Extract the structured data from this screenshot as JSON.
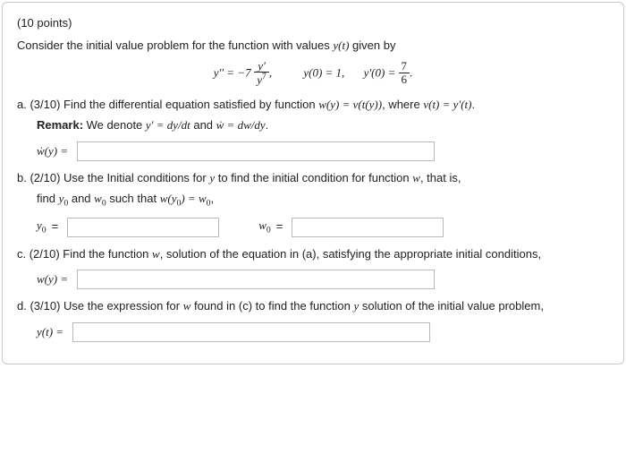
{
  "header": {
    "points": "(10 points)"
  },
  "intro": "Consider the initial value problem for the function with values ",
  "intro_tail": " given by",
  "eq": {
    "lhs": "y'' = −7",
    "num": "y'",
    "den_base": "y",
    "den_exp": "7",
    "comma": ",",
    "ic1": "y(0) = 1,",
    "ic2_lhs": "y'(0) = ",
    "ic2_num": "7",
    "ic2_den": "6",
    "ic2_tail": "."
  },
  "parts": {
    "a": {
      "prefix": "a.  (3/10) Find the differential equation satisfied by function ",
      "mid1": "w(y) = v(t(y))",
      "mid2": ", where ",
      "mid3": "v(t) = y'(t)",
      "mid4": ".",
      "remark_label": "Remark:",
      "remark_text": " We denote ",
      "remark_eq1": "y' = dy/dt",
      "remark_and": " and ",
      "remark_eq2": "ẇ = dw/dy",
      "remark_tail": ".",
      "field_label": "ẇ(y) ="
    },
    "b": {
      "prefix": "b.  (2/10) Use the Initial conditions for ",
      "var_y": "y",
      "mid1": " to find the initial condition for function ",
      "var_w": "w",
      "mid2": ", that is,",
      "line2a": "find ",
      "y0": "y",
      "line2b": " and ",
      "w0": "w",
      "line2c": " such that ",
      "eq": "w(y",
      "eq2": ") = w",
      "eq3": ",",
      "field1": "y",
      "field1_eq": " =",
      "field2": "w",
      "field2_eq": " ="
    },
    "c": {
      "prefix": "c.  (2/10) Find the function ",
      "var_w": "w",
      "mid": ", solution of the equation in (a), satisfying the appropriate initial conditions,",
      "field_label": "w(y) ="
    },
    "d": {
      "prefix": "d.  (3/10) Use the expression for ",
      "var_w": "w",
      "mid1": " found in (c) to find the function ",
      "var_y": "y",
      "mid2": " solution of the initial value problem,",
      "field_label": "y(t) ="
    }
  }
}
